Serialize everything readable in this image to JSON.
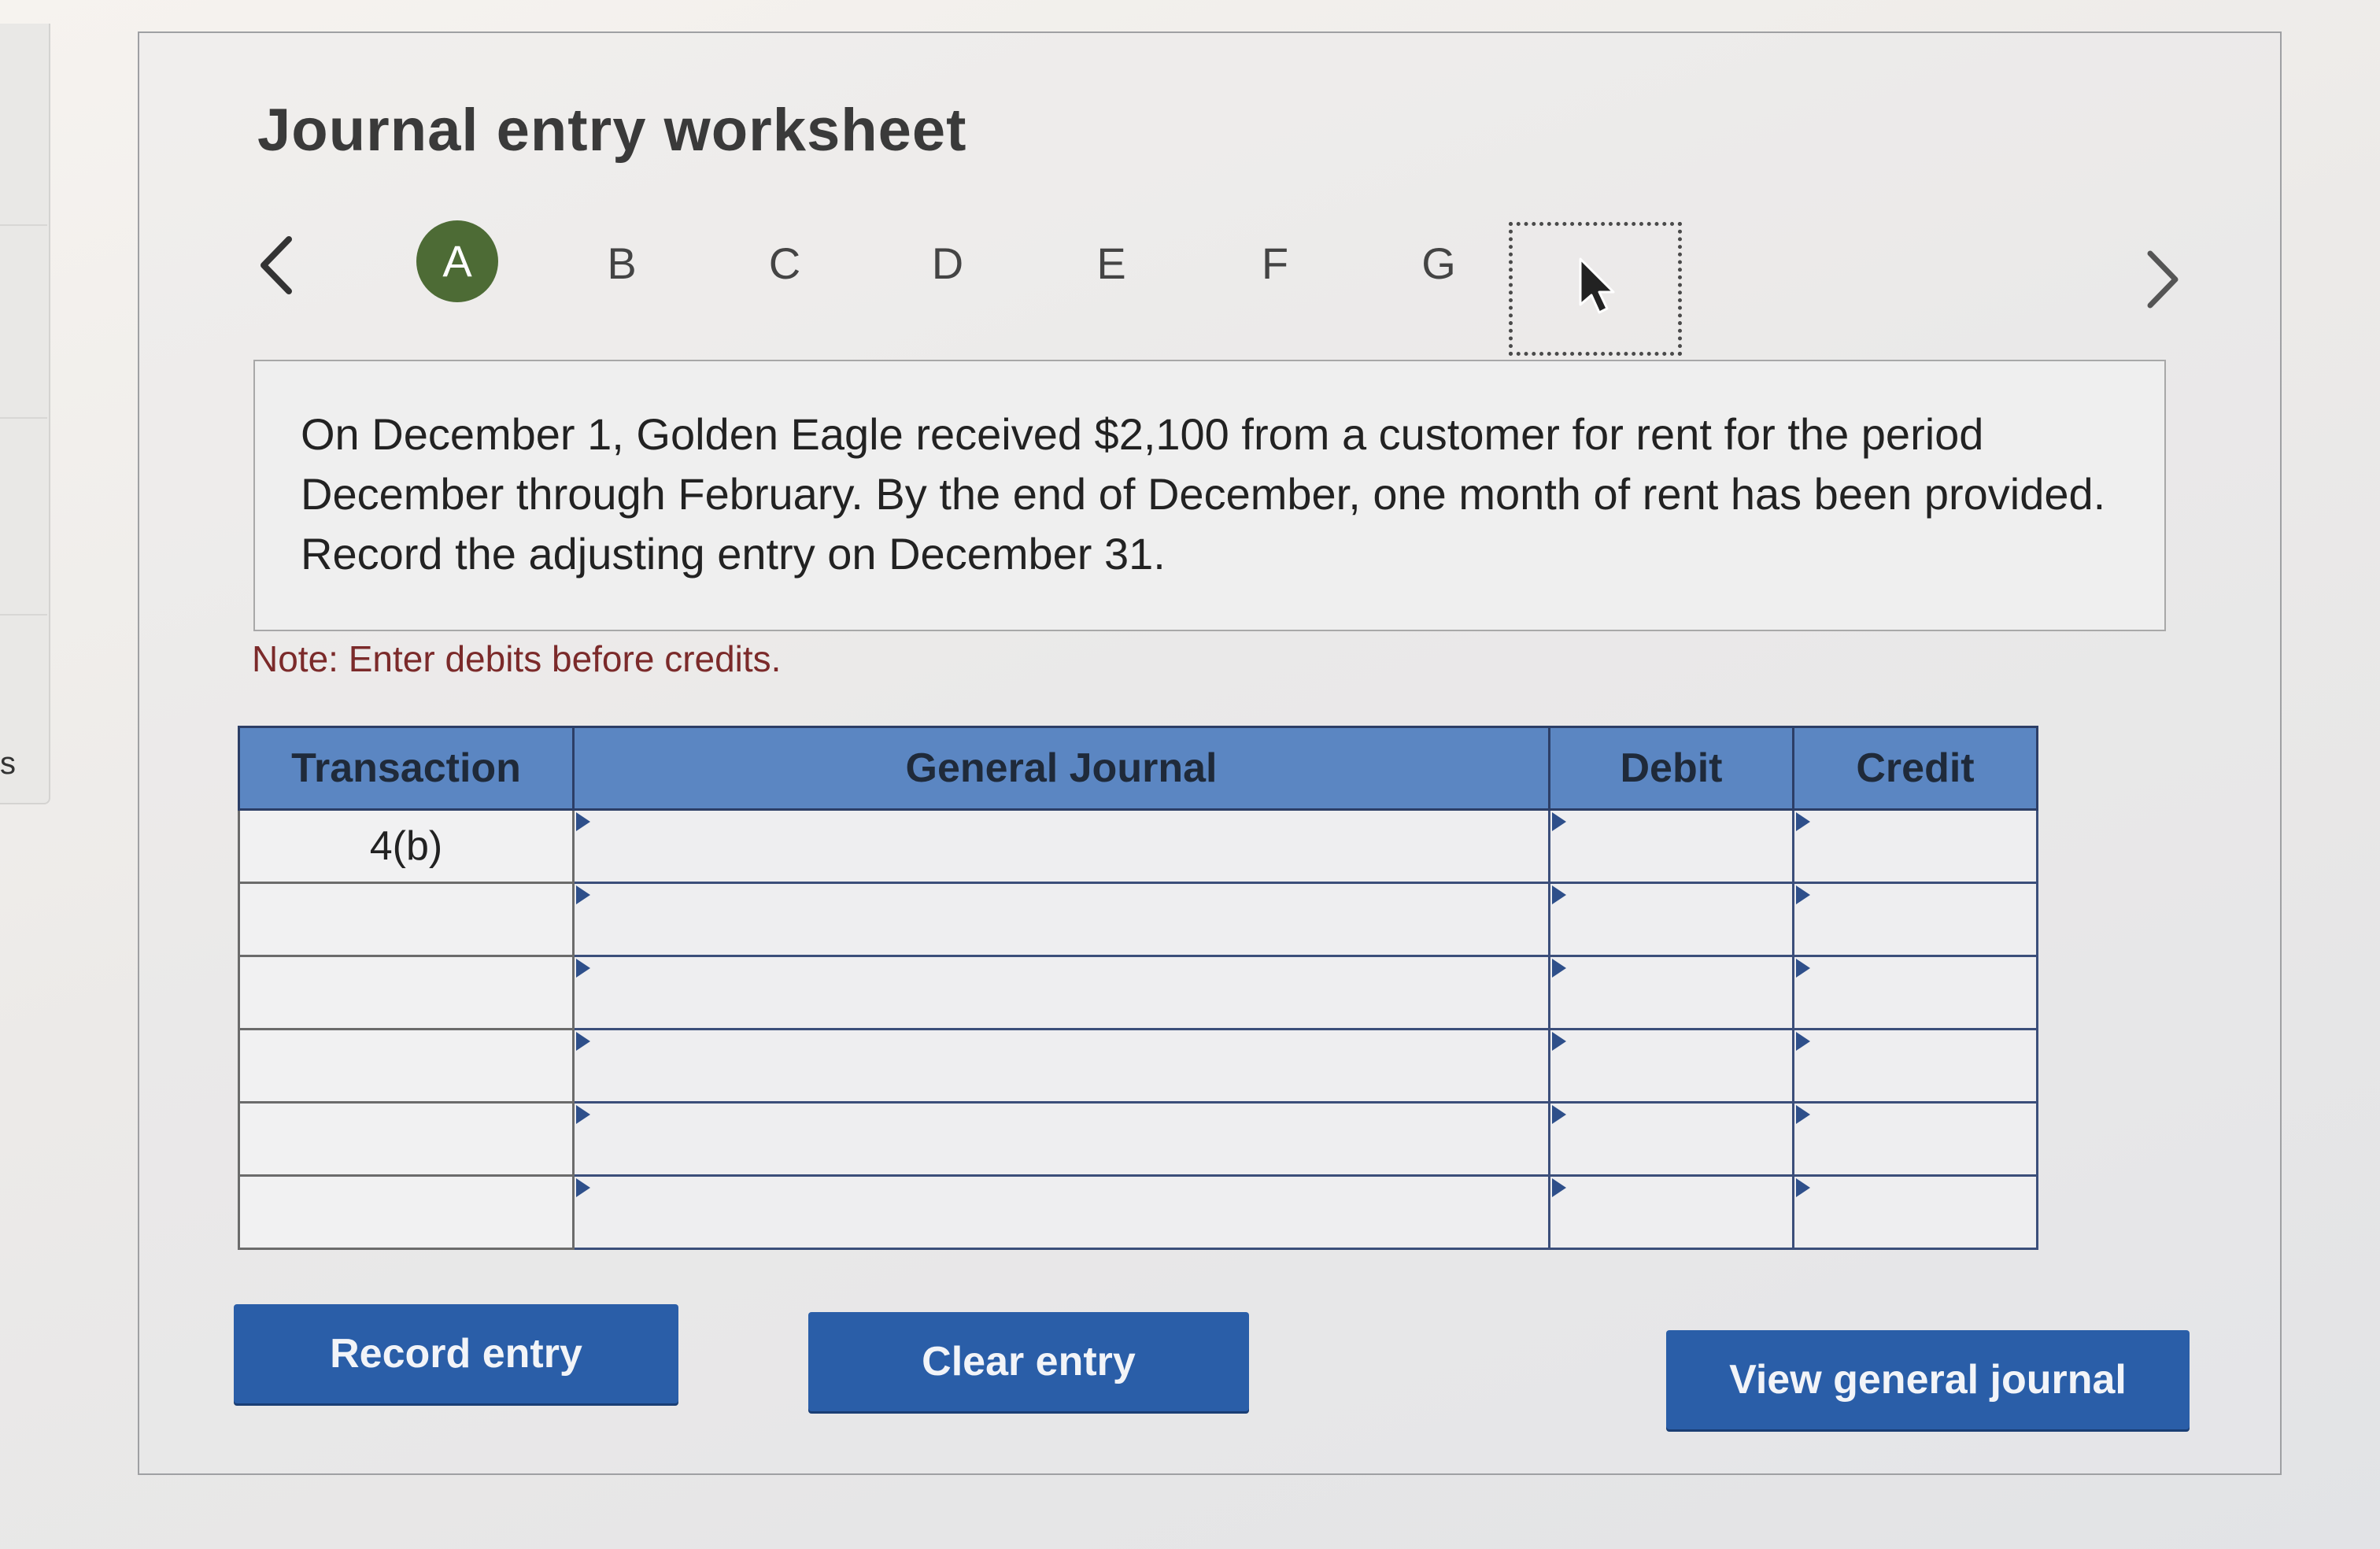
{
  "sidebar_edge": {
    "text": "s"
  },
  "worksheet": {
    "title": "Journal entry worksheet",
    "tabs": [
      {
        "label": "A",
        "active": true
      },
      {
        "label": "B",
        "active": false
      },
      {
        "label": "C",
        "active": false
      },
      {
        "label": "D",
        "active": false
      },
      {
        "label": "E",
        "active": false
      },
      {
        "label": "F",
        "active": false
      },
      {
        "label": "G",
        "active": false
      }
    ],
    "question": "On December 1, Golden Eagle received $2,100 from a customer for rent for the period December through February. By the end of December, one month of rent has been provided. Record the adjusting entry on December 31.",
    "note": "Note: Enter debits before credits."
  },
  "table": {
    "headers": {
      "transaction": "Transaction",
      "general_journal": "General Journal",
      "debit": "Debit",
      "credit": "Credit"
    },
    "rows": [
      {
        "transaction": "4(b)",
        "account": "",
        "debit": "",
        "credit": ""
      },
      {
        "transaction": "",
        "account": "",
        "debit": "",
        "credit": ""
      },
      {
        "transaction": "",
        "account": "",
        "debit": "",
        "credit": ""
      },
      {
        "transaction": "",
        "account": "",
        "debit": "",
        "credit": ""
      },
      {
        "transaction": "",
        "account": "",
        "debit": "",
        "credit": ""
      },
      {
        "transaction": "",
        "account": "",
        "debit": "",
        "credit": ""
      }
    ]
  },
  "buttons": {
    "record": "Record entry",
    "clear": "Clear entry",
    "view": "View general journal"
  },
  "colors": {
    "active_tab": "#4d6b35",
    "table_header": "#5b86c2",
    "button": "#2a5ea8",
    "note_text": "#7b2a2a"
  },
  "icons": {
    "prev": "chevron-left-icon",
    "next": "chevron-right-icon",
    "cursor": "mouse-pointer-icon"
  }
}
